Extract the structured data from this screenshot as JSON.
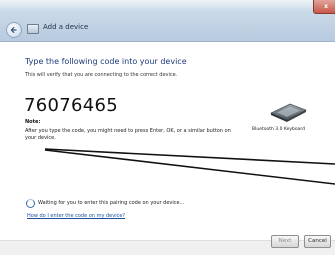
{
  "window": {
    "title": "Add a device",
    "close_label": "x"
  },
  "main": {
    "heading": "Type the following code into your device",
    "subheading": "This will verify that you are connecting to the correct device.",
    "pairing_code": "76076465",
    "note_label": "Note:",
    "note_text": "After you type the code, you might need to press Enter, OK, or a similar button on your device."
  },
  "device": {
    "icon": "keyboard-icon",
    "name": "Bluetooth 3.0 Keyboard"
  },
  "status": {
    "icon": "spinner-icon",
    "waiting_text": "Waiting for you to enter this pairing code on your device..."
  },
  "links": {
    "help": "How do I enter the code on my device?"
  },
  "footer": {
    "next_label": "Next",
    "cancel_label": "Cancel"
  }
}
